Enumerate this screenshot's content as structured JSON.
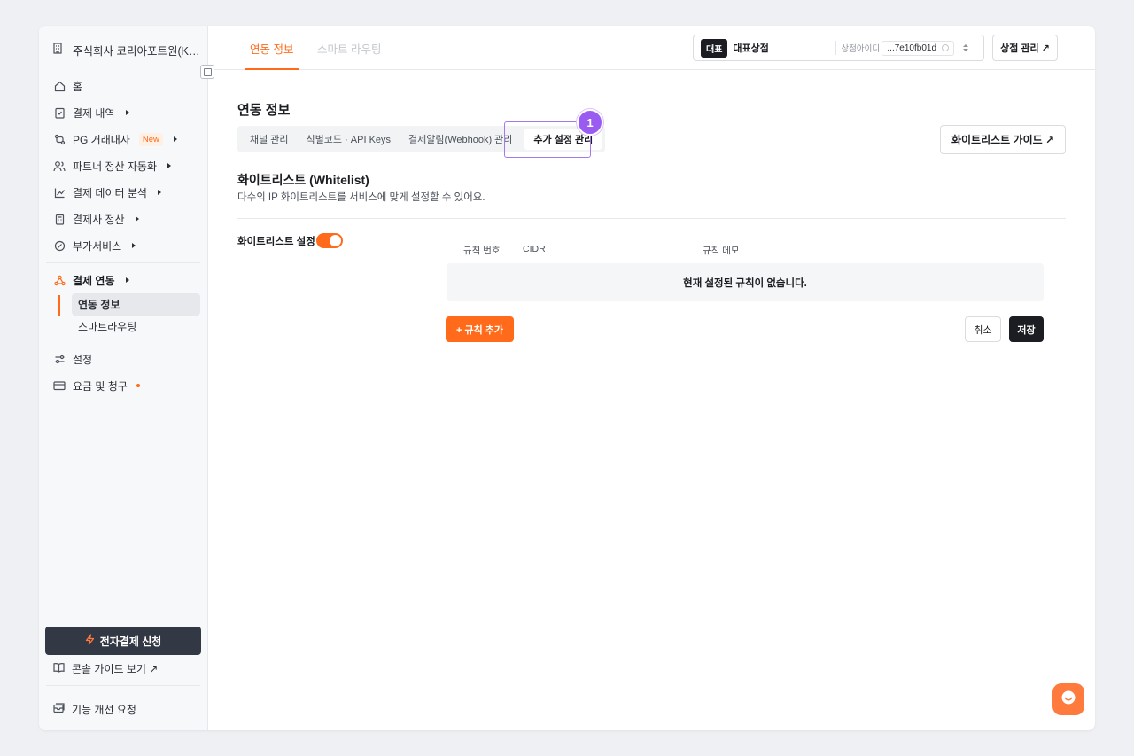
{
  "sidebar": {
    "company_name": "주식회사 코리아포트원(Kore...",
    "items": [
      {
        "label": "홈",
        "icon": "home-icon"
      },
      {
        "label": "결제 내역",
        "icon": "receipt-icon"
      },
      {
        "label": "PG 거래대사",
        "icon": "reconcile-icon",
        "badge": "New"
      },
      {
        "label": "파트너 정산 자동화",
        "icon": "users-icon"
      },
      {
        "label": "결제 데이터 분석",
        "icon": "chart-icon"
      },
      {
        "label": "결제사 정산",
        "icon": "calculator-icon"
      },
      {
        "label": "부가서비스",
        "icon": "plus-circle-icon"
      },
      {
        "label": "결제 연동",
        "icon": "integration-icon"
      },
      {
        "label": "설정",
        "icon": "sliders-icon"
      },
      {
        "label": "요금 및 청구",
        "icon": "card-icon"
      }
    ],
    "sub_items": [
      {
        "label": "연동 정보"
      },
      {
        "label": "스마트라우팅"
      }
    ],
    "apply_button": "전자결제 신청",
    "guide_link": "콘솔 가이드 보기 ↗",
    "feedback_link": "기능 개선 요청"
  },
  "header": {
    "tabs": [
      {
        "label": "연동 정보"
      },
      {
        "label": "스마트 라우팅"
      }
    ],
    "store": {
      "tag": "대표",
      "name": "대표상점",
      "id_label": "상점아이디",
      "id_value": "...7e10fb01d"
    },
    "manage_button": "상점 관리 ↗"
  },
  "main": {
    "title": "연동 정보",
    "subtabs": [
      {
        "label": "채널 관리"
      },
      {
        "label": "식별코드 · API Keys"
      },
      {
        "label": "결제알림(Webhook) 관리"
      },
      {
        "label": "추가 설정 관리"
      }
    ],
    "step_number": "1",
    "whitelist_guide_button": "화이트리스트 가이드 ↗",
    "section_title": "화이트리스트 (Whitelist)",
    "section_desc": "다수의 IP 화이트리스트를 서비스에 맞게 설정할 수 있어요.",
    "toggle_label": "화이트리스트 설정",
    "toggle_on": true,
    "table": {
      "headers": [
        "규칙 번호",
        "CIDR",
        "규칙 메모"
      ],
      "empty_text": "현재 설정된 규칙이 없습니다."
    },
    "add_rule_button": "+ 규칙 추가",
    "cancel_button": "취소",
    "save_button": "저장"
  },
  "colors": {
    "accent": "#ff6b1a",
    "highlight": "#a679ea",
    "dark": "#1b1d22"
  }
}
